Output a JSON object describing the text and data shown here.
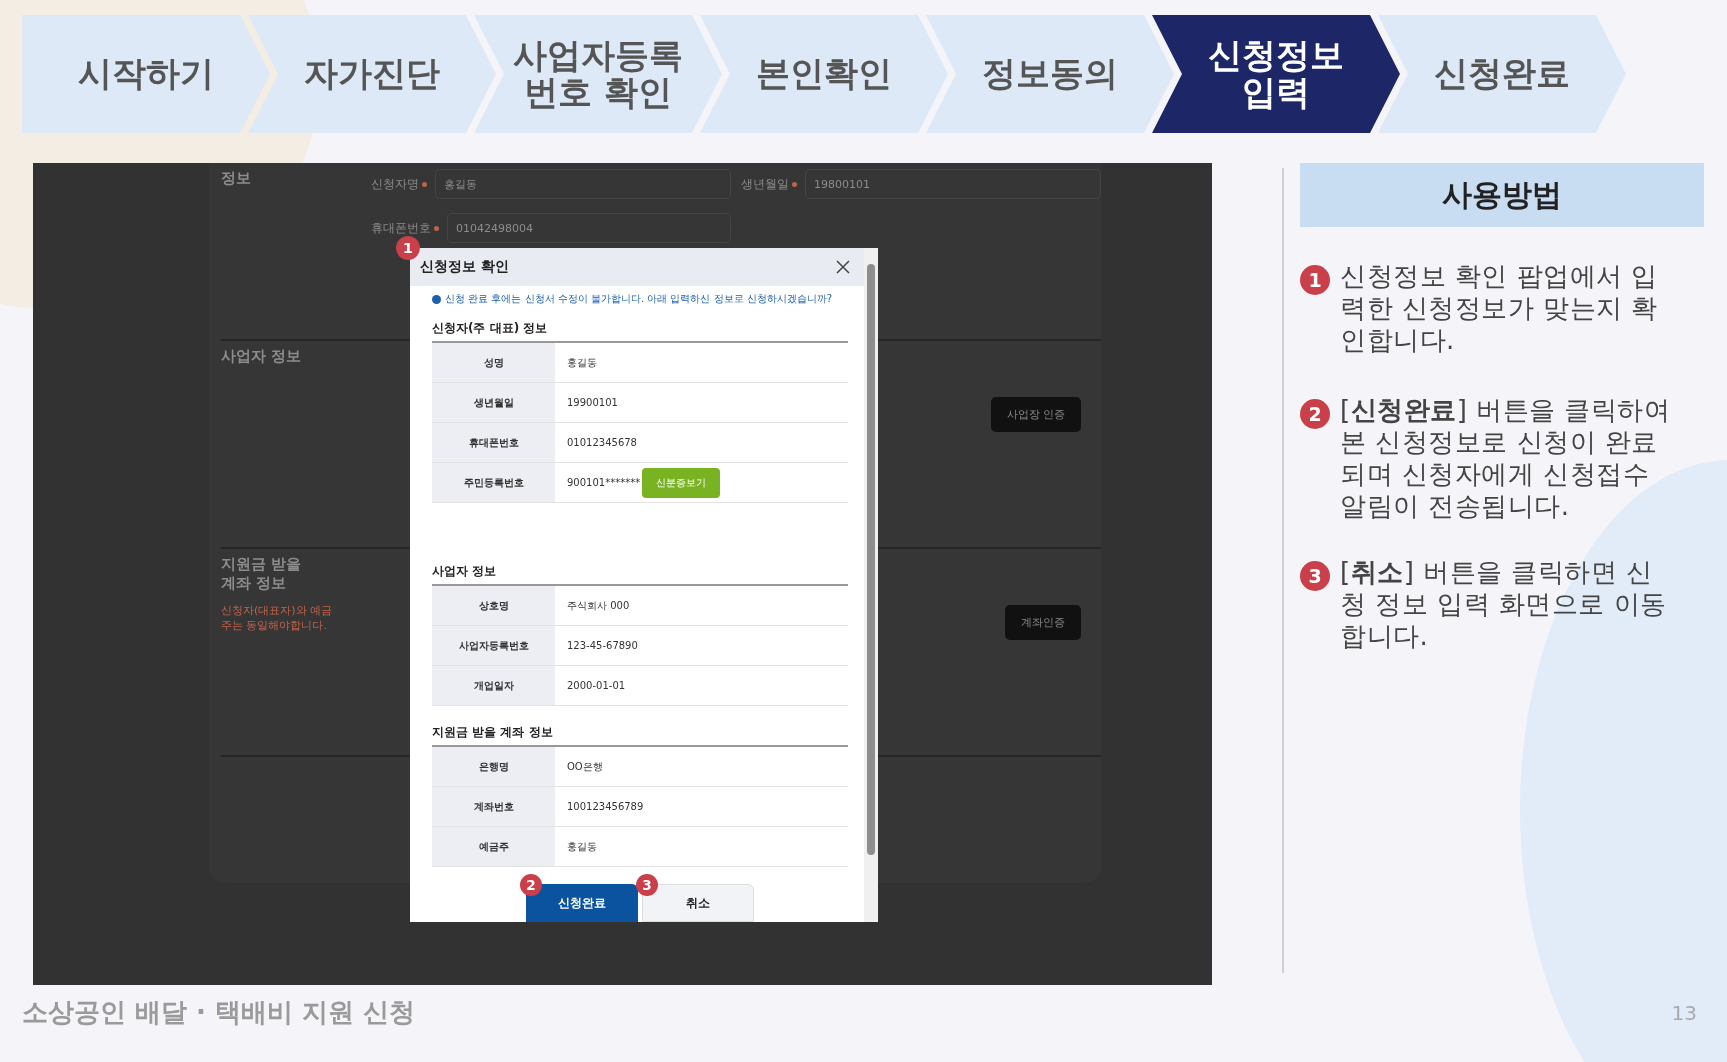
{
  "steps": [
    {
      "label": "시작하기",
      "selected": false
    },
    {
      "label": "자가진단",
      "selected": false
    },
    {
      "label": "사업자등록\n번호 확인",
      "selected": false
    },
    {
      "label": "본인확인",
      "selected": false
    },
    {
      "label": "정보동의",
      "selected": false
    },
    {
      "label": "신청정보\n입력",
      "selected": true
    },
    {
      "label": "신청완료",
      "selected": false
    }
  ],
  "background_form": {
    "sections": [
      {
        "title": "정보",
        "fields": [
          {
            "label": "신청자명",
            "required": true,
            "value": "홍길동"
          },
          {
            "label": "생년월일",
            "required": true,
            "value": "19800101"
          },
          {
            "label": "휴대폰번호",
            "required": true,
            "value": "01042498004"
          }
        ]
      },
      {
        "title": "사업자 정보",
        "button": "사업장 인증"
      },
      {
        "title": "지원금 받을\n계좌 정보",
        "note": "신청자(대표자)와 예금주는 동일해야합니다.",
        "button": "계좌인증"
      }
    ]
  },
  "modal": {
    "badge": "1",
    "title": "신청정보 확인",
    "notice": "신청 완료 후에는 신청서 수정이 불가합니다. 아래 입력하신 정보로 신청하시겠습니까?",
    "sections": [
      {
        "title": "신청자(주 대표) 정보",
        "rows": [
          {
            "label": "성명",
            "value": "홍길동"
          },
          {
            "label": "생년월일",
            "value": "19900101"
          },
          {
            "label": "휴대폰번호",
            "value": "01012345678"
          },
          {
            "label": "주민등록번호",
            "value": "900101*******",
            "button": "신분증보기"
          }
        ]
      },
      {
        "title": "사업자 정보",
        "rows": [
          {
            "label": "상호명",
            "value": "주식회사 000"
          },
          {
            "label": "사업자등록번호",
            "value": "123-45-67890"
          },
          {
            "label": "개업일자",
            "value": "2000-01-01"
          }
        ]
      },
      {
        "title": "지원금 받을 계좌 정보",
        "rows": [
          {
            "label": "은행명",
            "value": "OO은행"
          },
          {
            "label": "계좌번호",
            "value": "100123456789"
          },
          {
            "label": "예금주",
            "value": "홍길동"
          }
        ]
      }
    ],
    "buttons": [
      {
        "kind": "primary",
        "label": "신청완료",
        "badge": "2"
      },
      {
        "kind": "secondary",
        "label": "취소",
        "badge": "3"
      }
    ]
  },
  "help": {
    "title": "사용방법",
    "items": [
      {
        "number": "1",
        "text": "신청정보 확인 팝업에서 입력한 신청정보가 맞는지 확인합니다."
      },
      {
        "number": "2",
        "text": "[**신청완료**] 버튼을 클릭하여 본 신청정보로 신청이 완료되며 신청자에게 신청접수 알림이 전송됩니다."
      },
      {
        "number": "3",
        "text": "[**취소**] 버튼을 클릭하면 신청 정보 입력 화면으로 이동합니다."
      }
    ]
  },
  "footer": {
    "title": "소상공인 배달 · 택배비 지원 신청",
    "page": "13"
  }
}
